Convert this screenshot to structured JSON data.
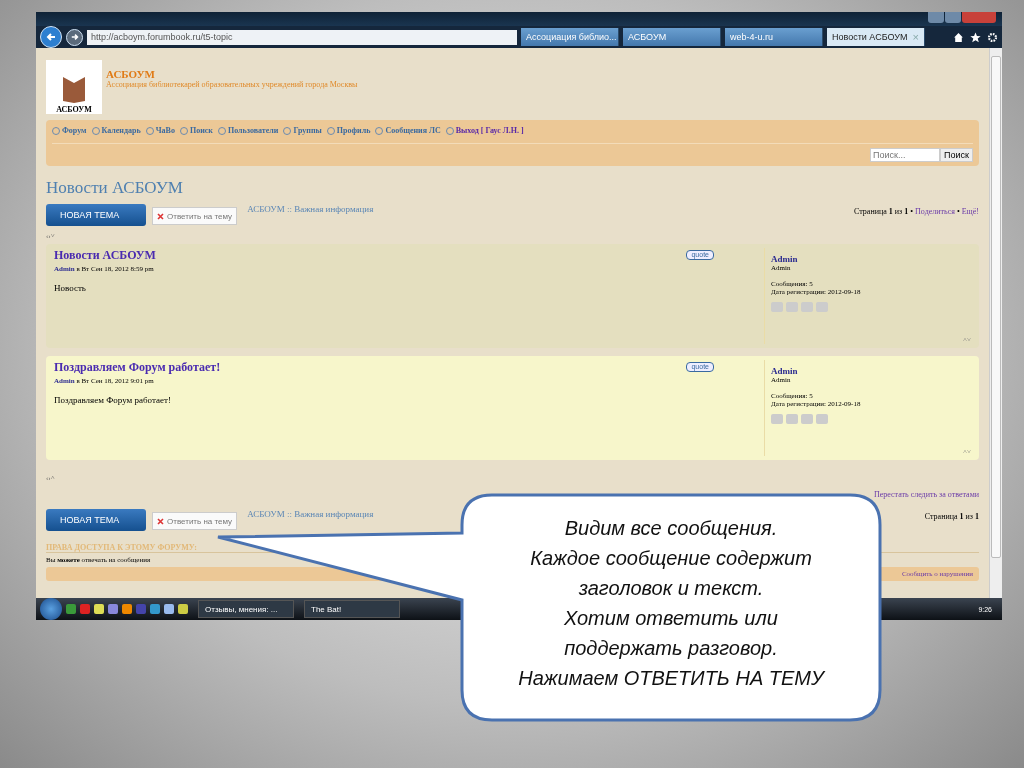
{
  "browser": {
    "address": "http://acboym.forumbook.ru/t5-topic",
    "tabs": [
      {
        "label": "Ассоциация библио...",
        "selected": false
      },
      {
        "label": "АСБОУМ",
        "selected": false
      },
      {
        "label": "web-4-u.ru",
        "selected": false
      },
      {
        "label": "Новости АСБОУМ",
        "selected": true
      }
    ],
    "close_glyph": "×"
  },
  "forum": {
    "logo_caption": "АСБОУМ",
    "site_title": "АСБОУМ",
    "site_subtitle": "Ассоциация библиотекарей образовательных учреждений города Москвы",
    "nav": [
      {
        "label": "Форум",
        "kind": "link"
      },
      {
        "label": "Календарь",
        "kind": "link"
      },
      {
        "label": "ЧаВо",
        "kind": "link"
      },
      {
        "label": "Поиск",
        "kind": "link"
      },
      {
        "label": "Пользователи",
        "kind": "link"
      },
      {
        "label": "Группы",
        "kind": "link"
      },
      {
        "label": "Профиль",
        "kind": "link"
      },
      {
        "label": "Сообщения ЛС",
        "kind": "link"
      },
      {
        "label": "Выход [ Гаус Л.Н. ]",
        "kind": "logout"
      }
    ],
    "search": {
      "placeholder": "Поиск...",
      "button": "Поиск"
    },
    "page_title": "Новости АСБОУМ",
    "top_actions": {
      "new_topic": "НОВАЯ ТЕМА",
      "reply": "Ответить на тему",
      "breadcrumb": "АСБОУМ :: Важная информация"
    },
    "pagination": {
      "text": "Страница **1** из **1** •",
      "links": [
        "Поделиться",
        "Ещё!"
      ],
      "separator": "•"
    },
    "jump_top": "‹›˅",
    "posts": [
      {
        "title": "Новости АСБОУМ",
        "author": "Admin",
        "date": "в Вт Сен 18, 2012 8:59 pm",
        "body": "Новость",
        "quote": "quote",
        "name": "Admin",
        "rank": "Admin",
        "posts": "Сообщения: 5",
        "registered": "Дата регистрации: 2012-09-18",
        "arrows": "˄˅"
      },
      {
        "title": "Поздравляем Форум работает!",
        "author": "Admin",
        "date": "в Вт Сен 18, 2012 9:01 pm",
        "body": "Поздравляем Форум работает!",
        "quote": "quote",
        "name": "Admin",
        "rank": "Admin",
        "posts": "Сообщения: 5",
        "registered": "Дата регистрации: 2012-09-18",
        "arrows": "˄˅"
      }
    ],
    "jump_bottom": "‹›˄",
    "unwatch": "Перестать следить за ответами",
    "bottom_actions": {
      "new_topic": "НОВАЯ ТЕМА",
      "reply": "Ответить на тему",
      "breadcrumb": "АСБОУМ :: Важная информация",
      "pagination": "Страница **1** из **1**"
    },
    "permissions_title": "ПРАВА ДОСТУПА К ЭТОМУ ФОРУМУ:",
    "permissions_text": "Вы **можете** отвечать на сообщения",
    "report": "Сообщить о нарушении"
  },
  "taskbar": {
    "tasks": [
      "Отзывы, мнения: ...",
      "The Bat!"
    ],
    "clock": "9:26"
  },
  "callout": {
    "lines": [
      "Видим все сообщения.",
      "Каждое сообщение содержит",
      "заголовок и текст.",
      "Хотим ответить или",
      "поддержать разговор.",
      "Нажимаем ОТВЕТИТЬ НА ТЕМУ"
    ]
  }
}
